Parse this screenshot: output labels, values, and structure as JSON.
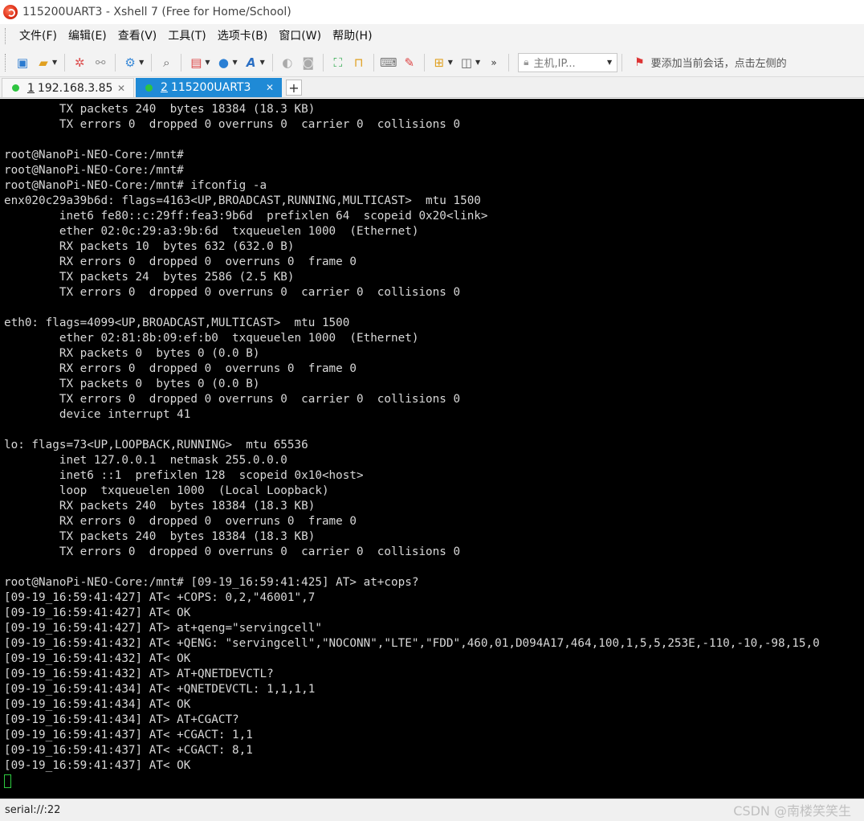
{
  "window": {
    "title": "115200UART3 - Xshell 7 (Free for Home/School)"
  },
  "menu": {
    "items": [
      "文件(F)",
      "编辑(E)",
      "查看(V)",
      "工具(T)",
      "选项卡(B)",
      "窗口(W)",
      "帮助(H)"
    ]
  },
  "toolbar": {
    "host_placeholder": "主机,IP...",
    "hint": "要添加当前会话，点击左侧的"
  },
  "tabs": [
    {
      "number": "1",
      "label": "192.168.3.85",
      "active": false
    },
    {
      "number": "2",
      "label": "115200UART3",
      "active": true
    }
  ],
  "terminal": {
    "lines": [
      "        TX packets 240  bytes 18384 (18.3 KB)",
      "        TX errors 0  dropped 0 overruns 0  carrier 0  collisions 0",
      "",
      "root@NanoPi-NEO-Core:/mnt#",
      "root@NanoPi-NEO-Core:/mnt#",
      "root@NanoPi-NEO-Core:/mnt# ifconfig -a",
      "enx020c29a39b6d: flags=4163<UP,BROADCAST,RUNNING,MULTICAST>  mtu 1500",
      "        inet6 fe80::c:29ff:fea3:9b6d  prefixlen 64  scopeid 0x20<link>",
      "        ether 02:0c:29:a3:9b:6d  txqueuelen 1000  (Ethernet)",
      "        RX packets 10  bytes 632 (632.0 B)",
      "        RX errors 0  dropped 0  overruns 0  frame 0",
      "        TX packets 24  bytes 2586 (2.5 KB)",
      "        TX errors 0  dropped 0 overruns 0  carrier 0  collisions 0",
      "",
      "eth0: flags=4099<UP,BROADCAST,MULTICAST>  mtu 1500",
      "        ether 02:81:8b:09:ef:b0  txqueuelen 1000  (Ethernet)",
      "        RX packets 0  bytes 0 (0.0 B)",
      "        RX errors 0  dropped 0  overruns 0  frame 0",
      "        TX packets 0  bytes 0 (0.0 B)",
      "        TX errors 0  dropped 0 overruns 0  carrier 0  collisions 0",
      "        device interrupt 41",
      "",
      "lo: flags=73<UP,LOOPBACK,RUNNING>  mtu 65536",
      "        inet 127.0.0.1  netmask 255.0.0.0",
      "        inet6 ::1  prefixlen 128  scopeid 0x10<host>",
      "        loop  txqueuelen 1000  (Local Loopback)",
      "        RX packets 240  bytes 18384 (18.3 KB)",
      "        RX errors 0  dropped 0  overruns 0  frame 0",
      "        TX packets 240  bytes 18384 (18.3 KB)",
      "        TX errors 0  dropped 0 overruns 0  carrier 0  collisions 0",
      "",
      "root@NanoPi-NEO-Core:/mnt# [09-19_16:59:41:425] AT> at+cops?",
      "[09-19_16:59:41:427] AT< +COPS: 0,2,\"46001\",7",
      "[09-19_16:59:41:427] AT< OK",
      "[09-19_16:59:41:427] AT> at+qeng=\"servingcell\"",
      "[09-19_16:59:41:432] AT< +QENG: \"servingcell\",\"NOCONN\",\"LTE\",\"FDD\",460,01,D094A17,464,100,1,5,5,253E,-110,-10,-98,15,0",
      "[09-19_16:59:41:432] AT< OK",
      "[09-19_16:59:41:432] AT> AT+QNETDEVCTL?",
      "[09-19_16:59:41:434] AT< +QNETDEVCTL: 1,1,1,1",
      "[09-19_16:59:41:434] AT< OK",
      "[09-19_16:59:41:434] AT> AT+CGACT?",
      "[09-19_16:59:41:437] AT< +CGACT: 1,1",
      "[09-19_16:59:41:437] AT< +CGACT: 8,1",
      "[09-19_16:59:41:437] AT< OK"
    ]
  },
  "status": {
    "text": "serial://:22"
  },
  "watermark": "CSDN @南楼笑笑生"
}
